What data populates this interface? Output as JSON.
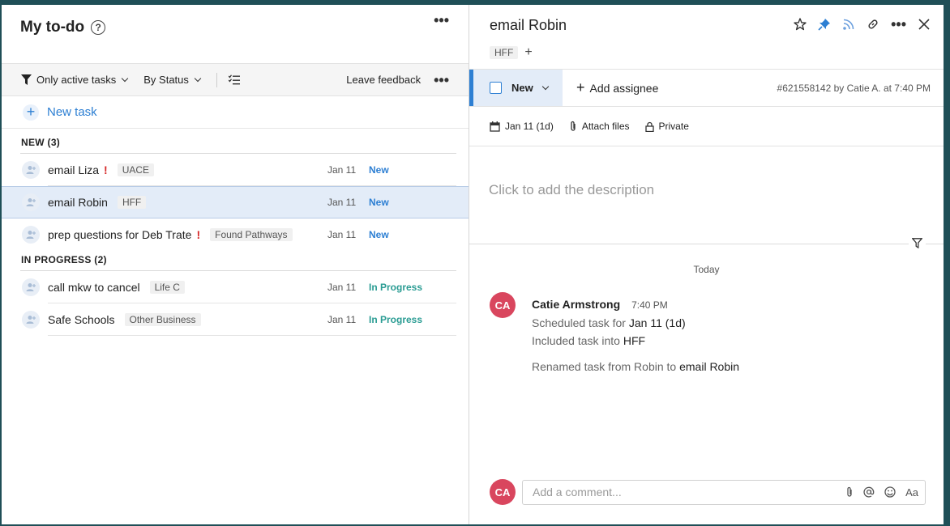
{
  "left": {
    "title": "My to-do",
    "help": "?",
    "toolbar": {
      "filter_label": "Only active tasks",
      "group_label": "By Status",
      "feedback_label": "Leave feedback"
    },
    "new_task_label": "New task",
    "groups": [
      {
        "header": "NEW (3)",
        "rows": [
          {
            "name": "email Liza",
            "urgent": true,
            "tag": "UACE",
            "date": "Jan 11",
            "status": "New"
          },
          {
            "name": "email Robin",
            "urgent": false,
            "tag": "HFF",
            "date": "Jan 11",
            "status": "New"
          },
          {
            "name": "prep questions for Deb Trate",
            "urgent": true,
            "tag": "Found Pathways",
            "date": "Jan 11",
            "status": "New"
          }
        ]
      },
      {
        "header": "IN PROGRESS (2)",
        "rows": [
          {
            "name": "call mkw to cancel",
            "urgent": false,
            "tag": "Life C",
            "date": "Jan 11",
            "status": "In Progress"
          },
          {
            "name": "Safe Schools",
            "urgent": false,
            "tag": "Other Business",
            "date": "Jan 11",
            "status": "In Progress"
          }
        ]
      }
    ],
    "urgent_mark": "!"
  },
  "right": {
    "title": "email Robin",
    "tag": "HFF",
    "add_tag": "+",
    "status_label": "New",
    "add_assignee_label": "Add assignee",
    "meta": "#621558142 by Catie A. at 7:40 PM",
    "attrs": {
      "date": "Jan 11 (1d)",
      "attach": "Attach files",
      "privacy": "Private"
    },
    "description_placeholder": "Click to add the description",
    "today_label": "Today",
    "activity": {
      "initials": "CA",
      "author": "Catie Armstrong",
      "time": "7:40 PM",
      "line1_prefix": "Scheduled task for ",
      "line1_value": "Jan 11 (1d)",
      "line2_prefix": "Included task into ",
      "line2_value": "HFF",
      "line3_prefix": "Renamed task from Robin to ",
      "line3_value": "email Robin"
    },
    "comment": {
      "initials": "CA",
      "placeholder": "Add a comment...",
      "format_label": "Aa"
    }
  },
  "colors": {
    "accent": "#2d7fd3",
    "in_progress": "#2a9c93",
    "avatar": "#d9465e",
    "urgent": "#d62a2a",
    "selected_row": "#e3ecf8"
  }
}
